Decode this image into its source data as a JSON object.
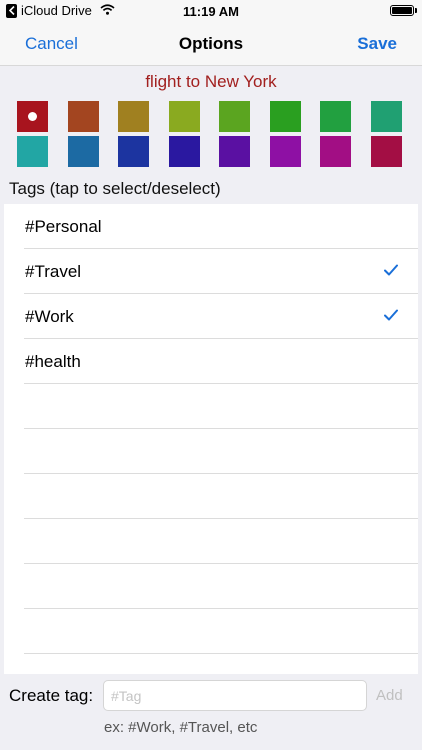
{
  "status_bar": {
    "back_app": "iCloud Drive",
    "time": "11:19 AM",
    "icons": [
      "back-chevron-icon",
      "wifi-icon",
      "battery-icon"
    ]
  },
  "nav": {
    "cancel_label": "Cancel",
    "title": "Options",
    "save_label": "Save",
    "accent_color": "#1a6fd8"
  },
  "note_title": "flight to New York",
  "note_title_color": "#a2201f",
  "colors": {
    "selected_index": 0,
    "row1": [
      "#a8141e",
      "#a34520",
      "#a08020",
      "#8aaa20",
      "#5ba520",
      "#2a9f20",
      "#22a040",
      "#20a072"
    ],
    "row2": [
      "#22a6a4",
      "#1c6aa3",
      "#1c34a0",
      "#2a18a0",
      "#5a10a2",
      "#8e10a4",
      "#a20e84",
      "#a30e44"
    ]
  },
  "tags_header": "Tags (tap to select/deselect)",
  "tags": [
    {
      "label": "#Personal",
      "selected": false
    },
    {
      "label": "#Travel",
      "selected": true
    },
    {
      "label": "#Work",
      "selected": true
    },
    {
      "label": "#health",
      "selected": false
    }
  ],
  "empty_rows": 6,
  "create": {
    "label": "Create tag:",
    "placeholder": "#Tag",
    "value": "",
    "add_label": "Add",
    "hint": "ex: #Work, #Travel, etc"
  }
}
